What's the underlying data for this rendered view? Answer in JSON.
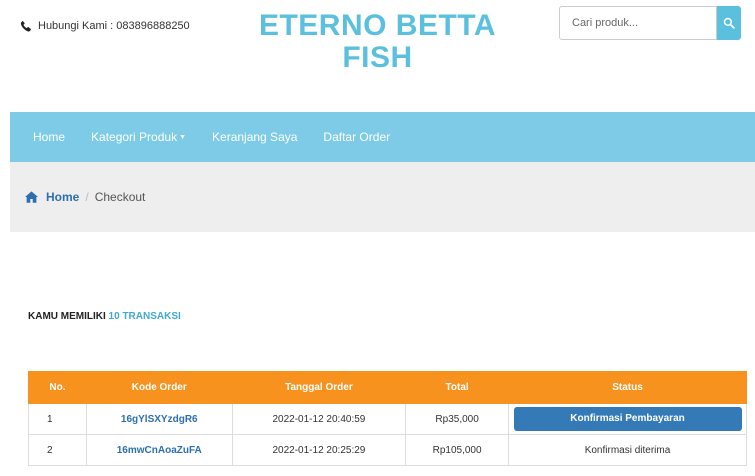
{
  "header": {
    "contact_label": "Hubungi Kami : 083896888250",
    "brand_line1": "ETERNO BETTA",
    "brand_line2": "FISH",
    "search_placeholder": "Cari produk..."
  },
  "nav": {
    "items": [
      "Home",
      "Kategori Produk",
      "Keranjang Saya",
      "Daftar Order"
    ]
  },
  "breadcrumb": {
    "home": "Home",
    "separator": "/",
    "current": "Checkout"
  },
  "summary": {
    "prefix": "KAMU MEMILIKI ",
    "count": "10 TRANSAKSI"
  },
  "table": {
    "headers": [
      "No.",
      "Kode Order",
      "Tanggal Order",
      "Total",
      "Status"
    ],
    "rows": [
      {
        "no": "1",
        "code": "16gYlSXYzdgR6",
        "date": "2022-01-12 20:40:59",
        "total": "Rp35,000",
        "status": "Konfirmasi Pembayaran"
      },
      {
        "no": "2",
        "code": "16mwCnAoaZuFA",
        "date": "2022-01-12 20:25:29",
        "total": "Rp105,000",
        "status": "Konfirmasi diterima"
      }
    ]
  },
  "colors": {
    "brand": "#5bc0de",
    "navbar": "#7dcbe6",
    "table_header": "#f7921e",
    "button_primary": "#337ab7",
    "link": "#2c6fb0"
  },
  "icons": {
    "phone": "phone-icon",
    "search": "search-icon",
    "home": "home-icon",
    "caret": "caret-down-icon"
  }
}
